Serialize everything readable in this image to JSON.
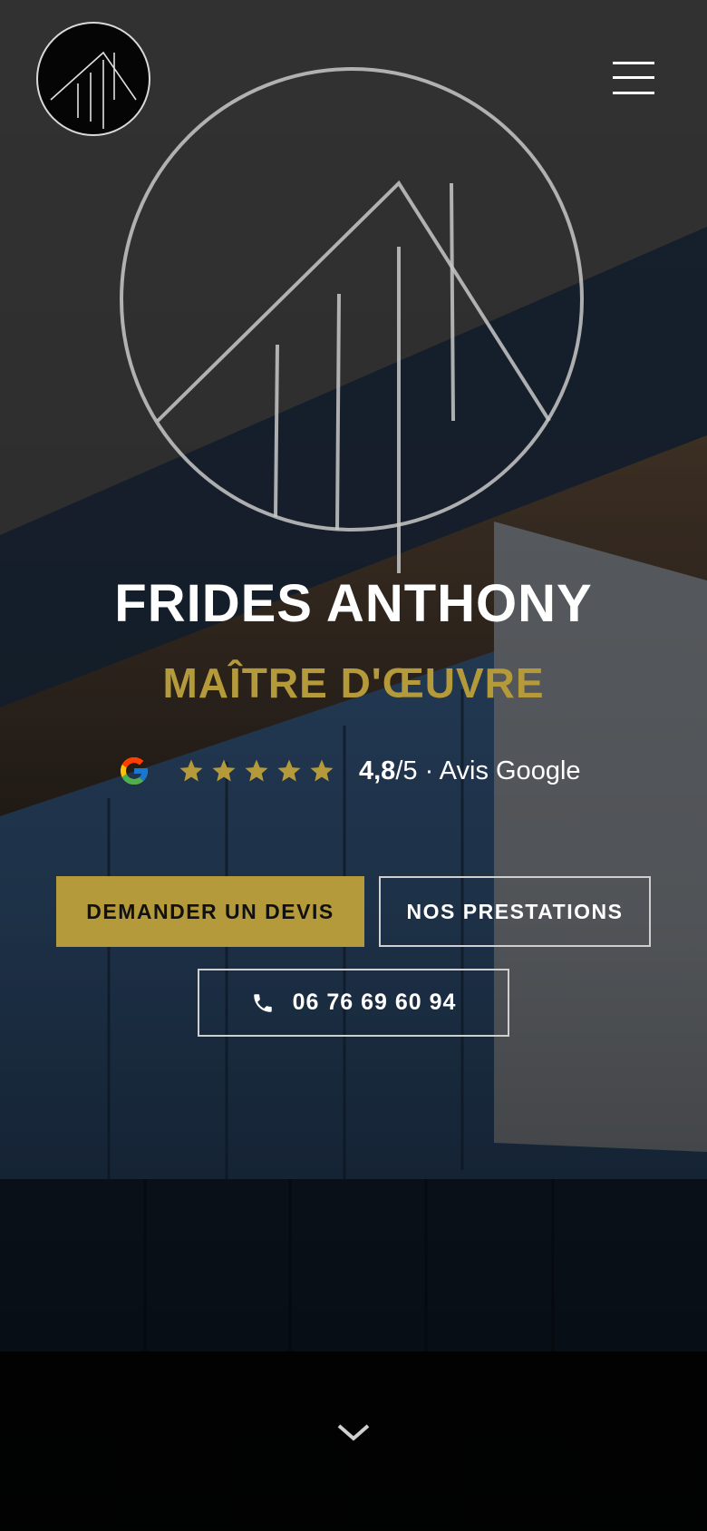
{
  "header": {
    "logo_icon": "frides-logo-icon",
    "menu_icon": "hamburger-menu-icon"
  },
  "hero": {
    "title": "FRIDES ANTHONY",
    "subtitle": "MAÎTRE D'ŒUVRE",
    "accent_color": "#b49a3a",
    "rating": {
      "source_icon": "google-g-icon",
      "stars": 5,
      "score": "4,8",
      "suffix": "/5 · Avis Google"
    },
    "buttons": {
      "devis_label": "DEMANDER UN DEVIS",
      "prestations_label": "NOS PRESTATIONS",
      "phone_label": "06 76 69 60 94",
      "phone_icon": "phone-icon"
    },
    "scroll_icon": "chevron-down-icon"
  }
}
